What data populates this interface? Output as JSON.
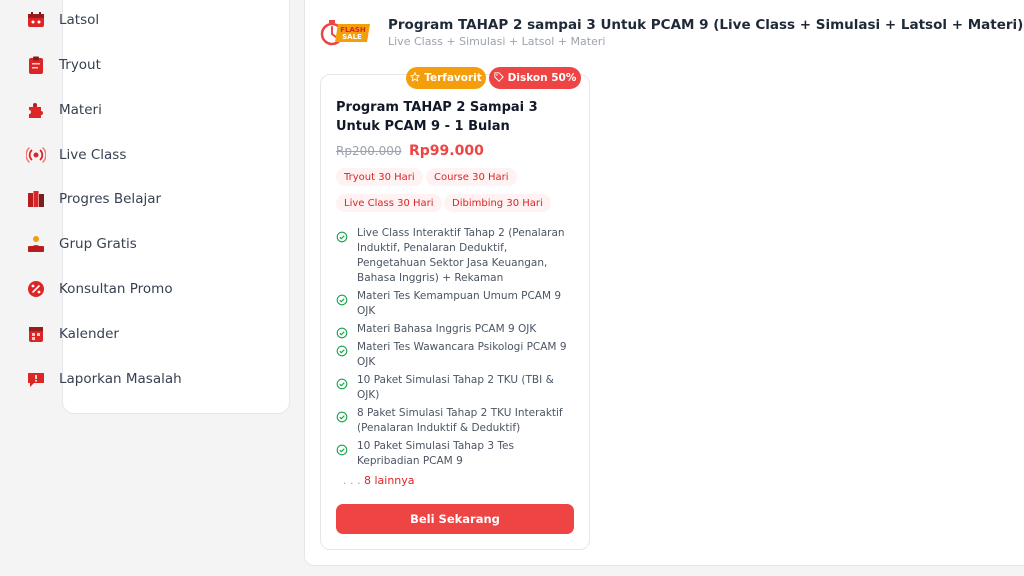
{
  "sidebar": {
    "items": [
      {
        "label": "Latsol",
        "icon": "calendar-shop-icon"
      },
      {
        "label": "Tryout",
        "icon": "clipboard-icon"
      },
      {
        "label": "Materi",
        "icon": "puzzle-icon"
      },
      {
        "label": "Live Class",
        "icon": "broadcast-icon"
      },
      {
        "label": "Progres Belajar",
        "icon": "books-icon"
      },
      {
        "label": "Grup Gratis",
        "icon": "group-icon"
      },
      {
        "label": "Konsultan Promo",
        "icon": "percent-badge-icon"
      },
      {
        "label": "Kalender",
        "icon": "calendar-icon"
      },
      {
        "label": "Laporkan Masalah",
        "icon": "report-message-icon"
      }
    ]
  },
  "header": {
    "title": "Program TAHAP 2 sampai 3 Untuk PCAM 9 (Live Class + Simulasi + Latsol + Materi)",
    "subtitle": "Live Class + Simulasi + Latsol + Materi",
    "logo_text_1": "FLASH",
    "logo_text_2": "SALE"
  },
  "card": {
    "badge_favorite": "Terfavorit",
    "badge_discount": "Diskon 50%",
    "title": "Program TAHAP 2 Sampai 3 Untuk PCAM 9 - 1 Bulan",
    "price_old": "Rp200.000",
    "price_new": "Rp99.000",
    "tags": [
      "Tryout 30 Hari",
      "Course 30 Hari",
      "Live Class 30 Hari",
      "Dibimbing 30 Hari"
    ],
    "features": [
      "Live Class Interaktif Tahap 2 (Penalaran Induktif, Penalaran Deduktif, Pengetahuan Sektor Jasa Keuangan, Bahasa Inggris) + Rekaman",
      "Materi Tes Kemampuan Umum PCAM 9 OJK",
      "Materi Bahasa Inggris PCAM 9 OJK",
      "Materi Tes Wawancara Psikologi PCAM 9 OJK",
      "10 Paket Simulasi Tahap 2 TKU (TBI & OJK)",
      "8 Paket Simulasi Tahap 2 TKU Interaktif (Penalaran Induktif & Deduktif)",
      "10 Paket Simulasi Tahap 3 Tes Kepribadian PCAM 9"
    ],
    "more_dots": ". . .",
    "more_text": "8 lainnya",
    "buy_label": "Beli Sekarang"
  },
  "colors": {
    "accent": "#ef4444",
    "favorite": "#f59e0b",
    "check": "#16a34a"
  }
}
